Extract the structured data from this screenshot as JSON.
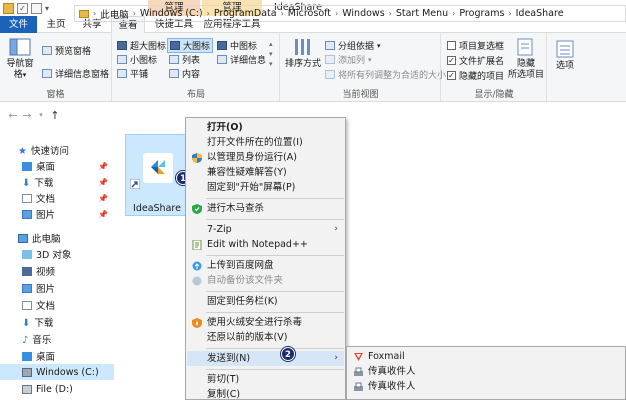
{
  "window": {
    "title": "IdeaShare"
  },
  "context_tab_headers": {
    "manage1": "管理",
    "manage2": "管理"
  },
  "tabs": {
    "file": "文件",
    "home": "主页",
    "share": "共享",
    "view": "查看",
    "shortcut": "快捷工具",
    "apptools": "应用程序工具"
  },
  "ribbon": {
    "panes": {
      "label": "窗格",
      "nav_pane": "导航窗格",
      "preview_pane": "预览窗格",
      "details_pane": "详细信息窗格"
    },
    "layout": {
      "label": "布局",
      "extra_large_icons": "超大图标",
      "large_icons": "大图标",
      "medium_icons": "中图标",
      "small_icons": "小图标",
      "list": "列表",
      "details": "详细信息",
      "tiles": "平铺",
      "content": "内容"
    },
    "current_view": {
      "label": "当前视图",
      "sort_by": "排序方式",
      "group_by": "分组依据",
      "add_columns": "添加列",
      "size_all_columns": "将所有列调整为合适的大小"
    },
    "show_hide": {
      "label": "显示/隐藏",
      "item_checkboxes": "项目复选框",
      "file_extensions": "文件扩展名",
      "hidden_items": "隐藏的项目",
      "hide_selected_line1": "隐藏",
      "hide_selected_line2": "所选项目",
      "options": "选项"
    }
  },
  "address": {
    "crumbs": [
      "此电脑",
      "Windows (C:)",
      "ProgramData",
      "Microsoft",
      "Windows",
      "Start Menu",
      "Programs",
      "IdeaShare"
    ]
  },
  "nav": {
    "quick_access": "快速访问",
    "quick_items": [
      "桌面",
      "下载",
      "文档",
      "图片"
    ],
    "this_pc": "此电脑",
    "pc_items": [
      "3D 对象",
      "视频",
      "图片",
      "文档",
      "下载",
      "音乐",
      "桌面"
    ],
    "drive_c": "Windows (C:)",
    "drive_d": "File (D:)"
  },
  "file_item": {
    "name": "IdeaShare"
  },
  "context_menu": {
    "open": "打开(O)",
    "open_location": "打开文件所在的位置(I)",
    "run_as_admin": "以管理员身份运行(A)",
    "troubleshoot": "兼容性疑难解答(Y)",
    "pin_start": "固定到\"开始\"屏幕(P)",
    "trojan_scan": "进行木马查杀",
    "seven_zip": "7-Zip",
    "notepadpp": "Edit with Notepad++",
    "baidu_upload": "上传到百度网盘",
    "baidu_backup": "自动备份该文件夹",
    "pin_taskbar": "固定到任务栏(K)",
    "huorong_scan": "使用火绒安全进行杀毒",
    "restore_versions": "还原以前的版本(V)",
    "send_to": "发送到(N)",
    "cut": "剪切(T)",
    "copy": "复制(C)"
  },
  "badges": {
    "one": "1",
    "two": "2"
  },
  "submenu": {
    "foxmail": "Foxmail",
    "fax1": "传真收件人",
    "fax2": "传真收件人"
  },
  "colors": {
    "file_tab": "#1a63b8",
    "selection": "#cce8ff",
    "badge": "#1e2a6e",
    "manage1": "#f8d7b8",
    "manage2": "#fbe3b0"
  }
}
